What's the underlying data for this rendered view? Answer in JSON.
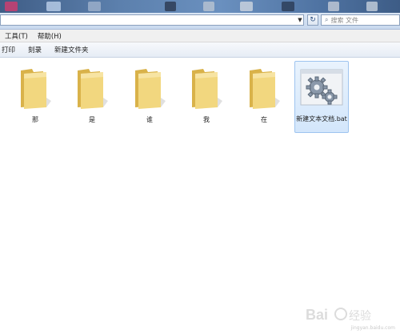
{
  "address_bar": {
    "search_placeholder": "搜索 文件"
  },
  "menu": {
    "items": [
      "工具(T)",
      "帮助(H)"
    ]
  },
  "toolbar": {
    "buttons": [
      "打印",
      "刻录",
      "新建文件夹"
    ]
  },
  "files": [
    {
      "name": "那",
      "type": "folder"
    },
    {
      "name": "是",
      "type": "folder"
    },
    {
      "name": "谁",
      "type": "folder"
    },
    {
      "name": "我",
      "type": "folder"
    },
    {
      "name": "在",
      "type": "folder"
    },
    {
      "name": "新建文本文档.bat",
      "type": "batch-file",
      "selected": true
    }
  ],
  "watermark": {
    "text": "jingyan.baidu.com"
  },
  "colors": {
    "folder_fill": "#f2d77f",
    "folder_dark": "#d9b24a",
    "selection": "#d3e6fb"
  }
}
